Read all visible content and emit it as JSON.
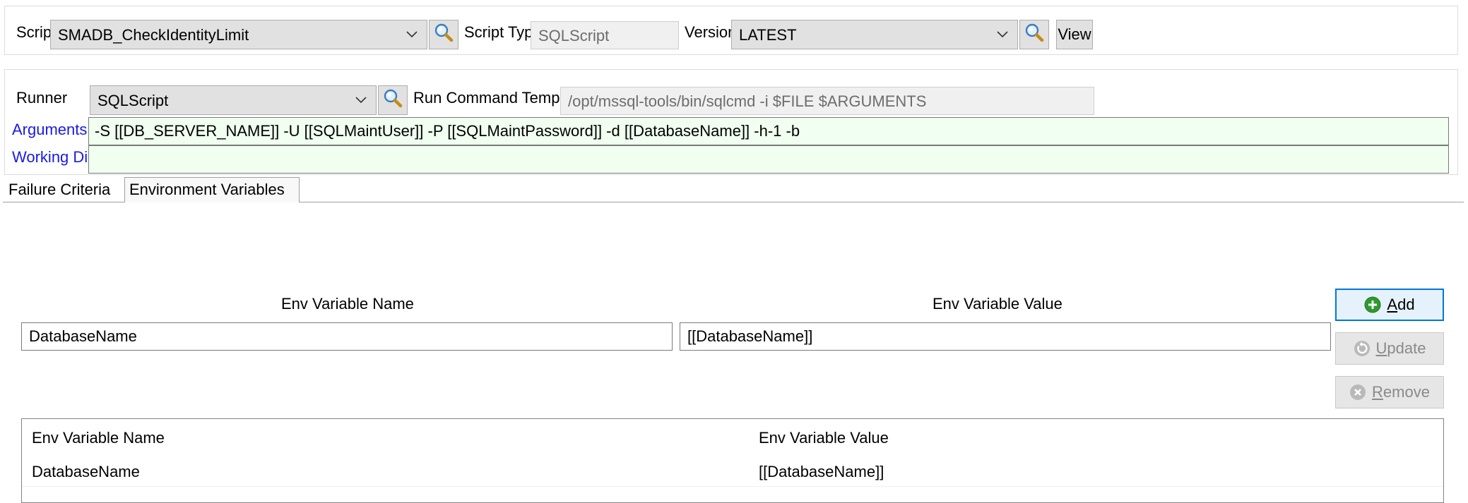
{
  "script_bar": {
    "script_label": "Script",
    "script_value": "SMADB_CheckIdentityLimit",
    "script_type_label": "Script Type",
    "script_type_value": "SQLScript",
    "version_label": "Version",
    "version_value": "LATEST",
    "view_label": "View"
  },
  "runner_panel": {
    "runner_label": "Runner",
    "runner_value": "SQLScript",
    "run_command_label": "Run Command Template",
    "run_command_value": "/opt/mssql-tools/bin/sqlcmd -i $FILE $ARGUMENTS",
    "arguments_label": "Arguments",
    "arguments_value": "-S [[DB_SERVER_NAME]] -U [[SQLMaintUser]] -P [[SQLMaintPassword]] -d [[DatabaseName]] -h-1 -b",
    "working_dir_label": "Working Dir.",
    "working_dir_value": ""
  },
  "tabs": [
    {
      "label": "Failure Criteria",
      "active": false
    },
    {
      "label": "Environment Variables",
      "active": true
    }
  ],
  "env_editor": {
    "name_header": "Env Variable Name",
    "value_header": "Env Variable Value",
    "name_value": "DatabaseName",
    "value_value": "[[DatabaseName]]",
    "add": {
      "accel": "A",
      "rest": "dd"
    },
    "update": {
      "accel": "U",
      "rest": "pdate"
    },
    "remove": {
      "accel": "R",
      "rest": "emove"
    }
  },
  "env_table": {
    "columns": [
      "Env Variable Name",
      "Env Variable Value"
    ],
    "rows": [
      [
        "DatabaseName",
        "[[DatabaseName]]"
      ]
    ]
  },
  "icons": {
    "search": "search-icon",
    "chevron": "chevron-down-icon",
    "add": "plus-circle-icon",
    "update": "refresh-icon",
    "remove": "remove-circle-icon"
  },
  "colors": {
    "link": "#1a1ae6",
    "field_green": "#f0fff0",
    "add_icon": "#2e9a2e",
    "focus_border": "#0078d7"
  }
}
